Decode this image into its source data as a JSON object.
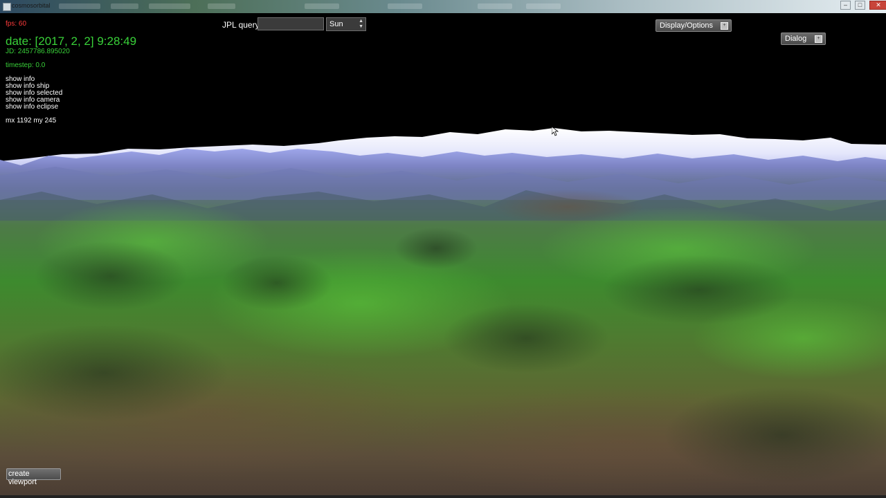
{
  "window": {
    "title": "cosmosorbital",
    "buttons": [
      "–",
      "□",
      "✕"
    ]
  },
  "hud": {
    "fps": "fps: 60",
    "date": "date: [2017, 2, 2] 9:28:49",
    "jd": "JD: 2457786.895020",
    "timestep": "timestep: 0.0",
    "info_items": [
      "show info",
      "show info ship",
      "show info selected",
      "show info camera",
      "show info eclipse"
    ],
    "mouse": "mx 1192 my 245"
  },
  "jpl": {
    "label": "JPL query:",
    "input_value": "",
    "selected": "Sun",
    "spin_up": "▲",
    "spin_down": "▼"
  },
  "panels": {
    "display_options": {
      "label": "Display/Options",
      "icon": "maximize-icon"
    },
    "dialog": {
      "label": "Dialog",
      "icon": "maximize-icon"
    }
  },
  "create_viewport": {
    "label": "create viewport"
  },
  "colors": {
    "fps": "#ff3b3b",
    "hud_green": "#39d139",
    "sky": "#000000",
    "snow": "#ffffff",
    "haze": "#a8a8e8",
    "grass": "#3f8a30",
    "soil": "#5a4a38"
  }
}
